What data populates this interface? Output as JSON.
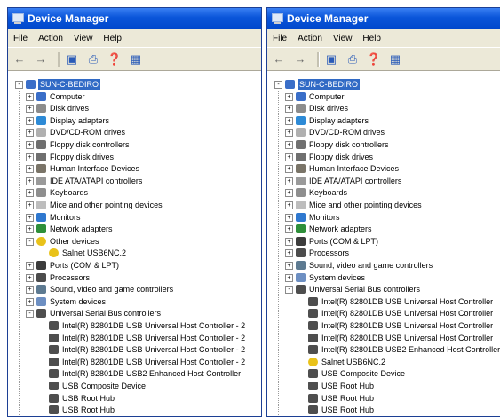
{
  "windows": [
    {
      "title": "Device Manager",
      "menu": [
        "File",
        "Action",
        "View",
        "Help"
      ],
      "root": "SUN-C-BEDIRO",
      "items": [
        {
          "depth": 1,
          "exp": "+",
          "icon": "i-pc",
          "label": "Computer"
        },
        {
          "depth": 1,
          "exp": "+",
          "icon": "i-disk",
          "label": "Disk drives"
        },
        {
          "depth": 1,
          "exp": "+",
          "icon": "i-disp",
          "label": "Display adapters"
        },
        {
          "depth": 1,
          "exp": "+",
          "icon": "i-dvd",
          "label": "DVD/CD-ROM drives"
        },
        {
          "depth": 1,
          "exp": "+",
          "icon": "i-flop",
          "label": "Floppy disk controllers"
        },
        {
          "depth": 1,
          "exp": "+",
          "icon": "i-flop",
          "label": "Floppy disk drives"
        },
        {
          "depth": 1,
          "exp": "+",
          "icon": "i-hid",
          "label": "Human Interface Devices"
        },
        {
          "depth": 1,
          "exp": "+",
          "icon": "i-ide",
          "label": "IDE ATA/ATAPI controllers"
        },
        {
          "depth": 1,
          "exp": "+",
          "icon": "i-kb",
          "label": "Keyboards"
        },
        {
          "depth": 1,
          "exp": "+",
          "icon": "i-mice",
          "label": "Mice and other pointing devices"
        },
        {
          "depth": 1,
          "exp": "+",
          "icon": "i-mon",
          "label": "Monitors"
        },
        {
          "depth": 1,
          "exp": "+",
          "icon": "i-net",
          "label": "Network adapters"
        },
        {
          "depth": 1,
          "exp": "-",
          "icon": "i-warn",
          "label": "Other devices"
        },
        {
          "depth": 2,
          "exp": "",
          "icon": "i-warn",
          "label": "Salnet USB6NC.2"
        },
        {
          "depth": 1,
          "exp": "+",
          "icon": "i-port",
          "label": "Ports (COM & LPT)"
        },
        {
          "depth": 1,
          "exp": "+",
          "icon": "i-cpu",
          "label": "Processors"
        },
        {
          "depth": 1,
          "exp": "+",
          "icon": "i-snd",
          "label": "Sound, video and game controllers"
        },
        {
          "depth": 1,
          "exp": "+",
          "icon": "i-sys",
          "label": "System devices"
        },
        {
          "depth": 1,
          "exp": "-",
          "icon": "i-usb",
          "label": "Universal Serial Bus controllers"
        },
        {
          "depth": 2,
          "exp": "",
          "icon": "i-usb",
          "label": "Intel(R) 82801DB USB Universal Host Controller - 2"
        },
        {
          "depth": 2,
          "exp": "",
          "icon": "i-usb",
          "label": "Intel(R) 82801DB USB Universal Host Controller - 2"
        },
        {
          "depth": 2,
          "exp": "",
          "icon": "i-usb",
          "label": "Intel(R) 82801DB USB Universal Host Controller - 2"
        },
        {
          "depth": 2,
          "exp": "",
          "icon": "i-usb",
          "label": "Intel(R) 82801DB USB Universal Host Controller - 2"
        },
        {
          "depth": 2,
          "exp": "",
          "icon": "i-usb",
          "label": "Intel(R) 82801DB USB2 Enhanced Host Controller"
        },
        {
          "depth": 2,
          "exp": "",
          "icon": "i-usb",
          "label": "USB Composite Device"
        },
        {
          "depth": 2,
          "exp": "",
          "icon": "i-usb",
          "label": "USB Root Hub"
        },
        {
          "depth": 2,
          "exp": "",
          "icon": "i-usb",
          "label": "USB Root Hub"
        }
      ]
    },
    {
      "title": "Device Manager",
      "menu": [
        "File",
        "Action",
        "View",
        "Help"
      ],
      "root": "SUN-C-BEDIRO",
      "items": [
        {
          "depth": 1,
          "exp": "+",
          "icon": "i-pc",
          "label": "Computer"
        },
        {
          "depth": 1,
          "exp": "+",
          "icon": "i-disk",
          "label": "Disk drives"
        },
        {
          "depth": 1,
          "exp": "+",
          "icon": "i-disp",
          "label": "Display adapters"
        },
        {
          "depth": 1,
          "exp": "+",
          "icon": "i-dvd",
          "label": "DVD/CD-ROM drives"
        },
        {
          "depth": 1,
          "exp": "+",
          "icon": "i-flop",
          "label": "Floppy disk controllers"
        },
        {
          "depth": 1,
          "exp": "+",
          "icon": "i-flop",
          "label": "Floppy disk drives"
        },
        {
          "depth": 1,
          "exp": "+",
          "icon": "i-hid",
          "label": "Human Interface Devices"
        },
        {
          "depth": 1,
          "exp": "+",
          "icon": "i-ide",
          "label": "IDE ATA/ATAPI controllers"
        },
        {
          "depth": 1,
          "exp": "+",
          "icon": "i-kb",
          "label": "Keyboards"
        },
        {
          "depth": 1,
          "exp": "+",
          "icon": "i-mice",
          "label": "Mice and other pointing devices"
        },
        {
          "depth": 1,
          "exp": "+",
          "icon": "i-mon",
          "label": "Monitors"
        },
        {
          "depth": 1,
          "exp": "+",
          "icon": "i-net",
          "label": "Network adapters"
        },
        {
          "depth": 1,
          "exp": "+",
          "icon": "i-port",
          "label": "Ports (COM & LPT)"
        },
        {
          "depth": 1,
          "exp": "+",
          "icon": "i-cpu",
          "label": "Processors"
        },
        {
          "depth": 1,
          "exp": "+",
          "icon": "i-snd",
          "label": "Sound, video and game controllers"
        },
        {
          "depth": 1,
          "exp": "+",
          "icon": "i-sys",
          "label": "System devices"
        },
        {
          "depth": 1,
          "exp": "-",
          "icon": "i-usb",
          "label": "Universal Serial Bus controllers"
        },
        {
          "depth": 2,
          "exp": "",
          "icon": "i-usb",
          "label": "Intel(R) 82801DB USB Universal Host Controller"
        },
        {
          "depth": 2,
          "exp": "",
          "icon": "i-usb",
          "label": "Intel(R) 82801DB USB Universal Host Controller"
        },
        {
          "depth": 2,
          "exp": "",
          "icon": "i-usb",
          "label": "Intel(R) 82801DB USB Universal Host Controller"
        },
        {
          "depth": 2,
          "exp": "",
          "icon": "i-usb",
          "label": "Intel(R) 82801DB USB Universal Host Controller"
        },
        {
          "depth": 2,
          "exp": "",
          "icon": "i-usb",
          "label": "Intel(R) 82801DB USB2 Enhanced Host Controller"
        },
        {
          "depth": 2,
          "exp": "",
          "icon": "i-warn",
          "label": "Salnet USB6NC.2"
        },
        {
          "depth": 2,
          "exp": "",
          "icon": "i-usb",
          "label": "USB Composite Device"
        },
        {
          "depth": 2,
          "exp": "",
          "icon": "i-usb",
          "label": "USB Root Hub"
        },
        {
          "depth": 2,
          "exp": "",
          "icon": "i-usb",
          "label": "USB Root Hub"
        },
        {
          "depth": 2,
          "exp": "",
          "icon": "i-usb",
          "label": "USB Root Hub"
        }
      ]
    }
  ]
}
